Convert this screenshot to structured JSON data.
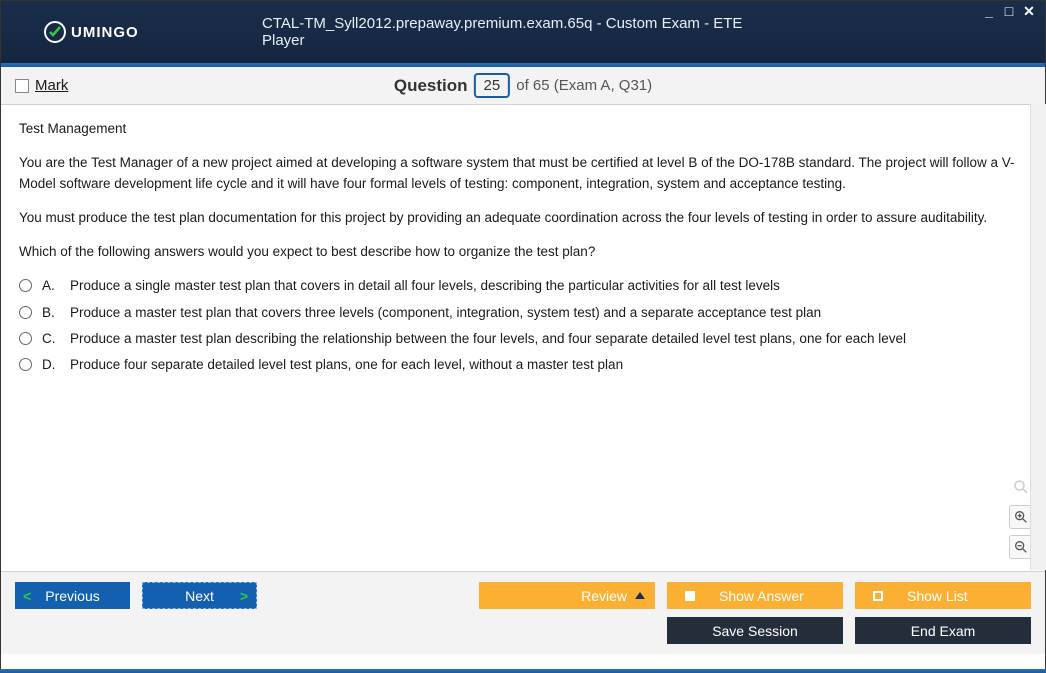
{
  "window": {
    "title": "CTAL-TM_Syll2012.prepaway.premium.exam.65q - Custom Exam - ETE Player",
    "logo_text": "UMINGO"
  },
  "infobar": {
    "mark_label": "Mark",
    "question_label": "Question",
    "current": "25",
    "of_text": "of 65 (Exam A, Q31)"
  },
  "question": {
    "topic": "Test Management",
    "para1": "You are the Test Manager of a new project aimed at developing a software system that must be certified at level B of the DO-178B standard. The project will follow a V-Model software development life cycle and it will have four formal levels of testing: component, integration, system and acceptance testing.",
    "para2": "You must produce the test plan documentation for this project by providing an adequate coordination across the four levels of testing in order to assure auditability.",
    "para3": "Which of the following answers would you expect to best describe how to organize the test plan?",
    "options": [
      {
        "letter": "A.",
        "text": "Produce a single master test plan that covers in detail all four levels, describing the particular activities for all test levels"
      },
      {
        "letter": "B.",
        "text": "Produce a master test plan that covers three levels (component, integration, system test) and a separate acceptance test plan"
      },
      {
        "letter": "C.",
        "text": "Produce a master test plan describing the relationship between the four levels, and four separate detailed level test plans, one for each level"
      },
      {
        "letter": "D.",
        "text": "Produce four separate detailed level test plans, one for each level, without a master test plan"
      }
    ]
  },
  "footer": {
    "previous": "Previous",
    "next": "Next",
    "review": "Review",
    "show_answer": "Show Answer",
    "show_list": "Show List",
    "save_session": "Save Session",
    "end_exam": "End Exam"
  }
}
